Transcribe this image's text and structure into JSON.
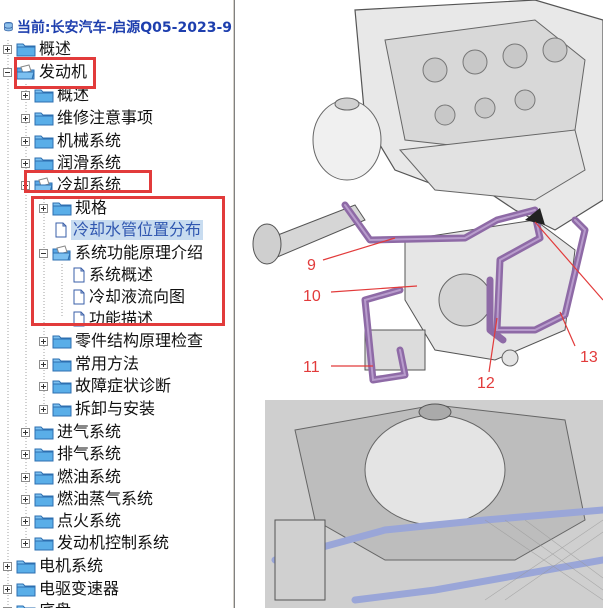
{
  "header": {
    "title": "当前:长安汽车-启源Q05-2023-9"
  },
  "tree": [
    {
      "label": "概述",
      "depth": 0,
      "type": "folder",
      "expander": "plus",
      "name": "tree-item-overview"
    },
    {
      "label": "发动机",
      "depth": 0,
      "type": "folder-open",
      "expander": "minus",
      "name": "tree-item-engine"
    },
    {
      "label": "概述",
      "depth": 1,
      "type": "folder",
      "expander": "plus",
      "name": "tree-item-engine-overview"
    },
    {
      "label": "维修注意事项",
      "depth": 1,
      "type": "folder",
      "expander": "plus",
      "name": "tree-item-maintenance-notes"
    },
    {
      "label": "机械系统",
      "depth": 1,
      "type": "folder",
      "expander": "plus",
      "name": "tree-item-mechanical-system"
    },
    {
      "label": "润滑系统",
      "depth": 1,
      "type": "folder",
      "expander": "plus",
      "name": "tree-item-lubrication-system"
    },
    {
      "label": "冷却系统",
      "depth": 1,
      "type": "folder-open",
      "expander": "minus",
      "name": "tree-item-cooling-system"
    },
    {
      "label": "规格",
      "depth": 2,
      "type": "folder",
      "expander": "plus",
      "name": "tree-item-specifications"
    },
    {
      "label": "冷却水管位置分布",
      "depth": 2,
      "type": "doc",
      "expander": "none",
      "selected": true,
      "name": "tree-item-coolant-pipe-layout"
    },
    {
      "label": "系统功能原理介绍",
      "depth": 2,
      "type": "folder-open",
      "expander": "minus",
      "name": "tree-item-system-principles"
    },
    {
      "label": "系统概述",
      "depth": 3,
      "type": "doc",
      "expander": "none",
      "name": "tree-item-system-overview"
    },
    {
      "label": "冷却液流向图",
      "depth": 3,
      "type": "doc",
      "expander": "none",
      "name": "tree-item-coolant-flow-diagram"
    },
    {
      "label": "功能描述",
      "depth": 3,
      "type": "doc",
      "expander": "none",
      "name": "tree-item-function-description"
    },
    {
      "label": "零件结构原理检查",
      "depth": 2,
      "type": "folder",
      "expander": "plus",
      "name": "tree-item-component-inspection"
    },
    {
      "label": "常用方法",
      "depth": 2,
      "type": "folder",
      "expander": "plus",
      "name": "tree-item-common-methods"
    },
    {
      "label": "故障症状诊断",
      "depth": 2,
      "type": "folder",
      "expander": "plus",
      "name": "tree-item-fault-diagnosis"
    },
    {
      "label": "拆卸与安装",
      "depth": 2,
      "type": "folder",
      "expander": "plus",
      "name": "tree-item-removal-installation"
    },
    {
      "label": "进气系统",
      "depth": 1,
      "type": "folder",
      "expander": "plus",
      "name": "tree-item-intake-system"
    },
    {
      "label": "排气系统",
      "depth": 1,
      "type": "folder",
      "expander": "plus",
      "name": "tree-item-exhaust-system"
    },
    {
      "label": "燃油系统",
      "depth": 1,
      "type": "folder",
      "expander": "plus",
      "name": "tree-item-fuel-system"
    },
    {
      "label": "燃油蒸气系统",
      "depth": 1,
      "type": "folder",
      "expander": "plus",
      "name": "tree-item-fuel-vapor-system"
    },
    {
      "label": "点火系统",
      "depth": 1,
      "type": "folder",
      "expander": "plus",
      "name": "tree-item-ignition-system"
    },
    {
      "label": "发动机控制系统",
      "depth": 1,
      "type": "folder",
      "expander": "plus",
      "name": "tree-item-engine-control-system"
    },
    {
      "label": "电机系统",
      "depth": 0,
      "type": "folder",
      "expander": "plus",
      "name": "tree-item-motor-system"
    },
    {
      "label": "电驱变速器",
      "depth": 0,
      "type": "folder",
      "expander": "plus",
      "name": "tree-item-e-drive-transmission"
    },
    {
      "label": "底盘",
      "depth": 0,
      "type": "folder",
      "expander": "plus",
      "name": "tree-item-chassis"
    }
  ],
  "diagram": {
    "callouts": [
      {
        "id": "9",
        "label": "9"
      },
      {
        "id": "10",
        "label": "10"
      },
      {
        "id": "11",
        "label": "11"
      },
      {
        "id": "12",
        "label": "12"
      },
      {
        "id": "13",
        "label": "13"
      }
    ]
  },
  "colors": {
    "highlight_red": "#e23b3b",
    "header_blue": "#1e3fae",
    "selected_bg": "#c8dcf0",
    "hose_purple": "#8e6aa6",
    "pipe_blue": "#9aa6d8"
  }
}
